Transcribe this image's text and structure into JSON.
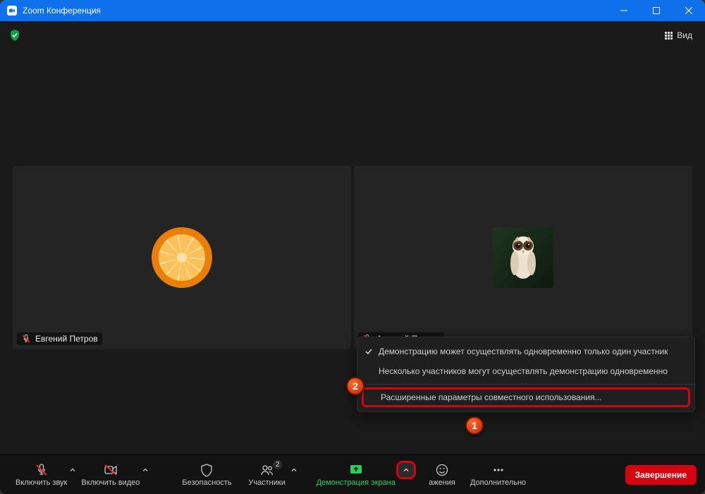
{
  "window": {
    "title": "Zoom Конференция"
  },
  "topbar": {
    "view_label": "Вид"
  },
  "participants": [
    {
      "name": "Евгений Петров",
      "muted": true,
      "avatar": "orange"
    },
    {
      "name": "Алексей Петров",
      "muted": true,
      "avatar": "owl"
    }
  ],
  "share_menu": {
    "option_one_only": "Демонстрацию может осуществлять одновременно только один участник",
    "option_multiple": "Несколько участников могут осуществлять демонстрацию одновременно",
    "advanced": "Расширенные параметры совместного использования...",
    "selected": "one_only"
  },
  "toolbar": {
    "audio": "Включить звук",
    "video": "Включить видео",
    "security": "Безопасность",
    "participants": "Участники",
    "participants_count": "2",
    "share": "Демонстрация экрана",
    "reactions": "ажения",
    "more": "Дополнительно",
    "end": "Завершение"
  },
  "callouts": {
    "one": "1",
    "two": "2"
  }
}
